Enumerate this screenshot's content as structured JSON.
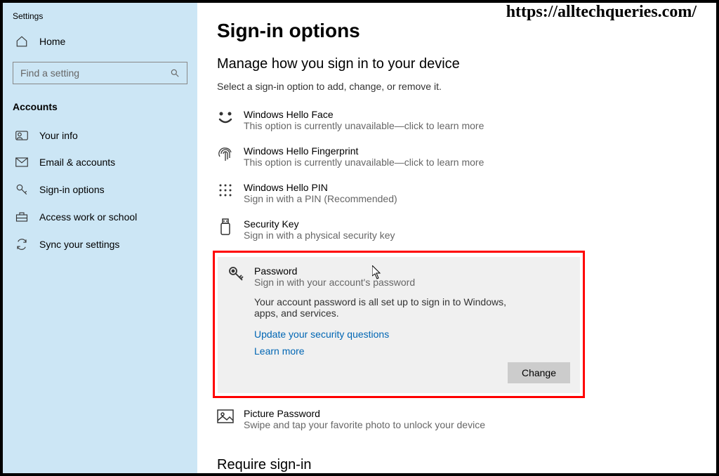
{
  "watermark": "https://alltechqueries.com/",
  "sidebar": {
    "title": "Settings",
    "home": "Home",
    "search_placeholder": "Find a setting",
    "section_header": "Accounts",
    "items": [
      {
        "label": "Your info"
      },
      {
        "label": "Email & accounts"
      },
      {
        "label": "Sign-in options"
      },
      {
        "label": "Access work or school"
      },
      {
        "label": "Sync your settings"
      }
    ]
  },
  "main": {
    "heading": "Sign-in options",
    "subheading": "Manage how you sign in to your device",
    "subtext": "Select a sign-in option to add, change, or remove it.",
    "options": {
      "face": {
        "title": "Windows Hello Face",
        "desc": "This option is currently unavailable—click to learn more"
      },
      "fingerprint": {
        "title": "Windows Hello Fingerprint",
        "desc": "This option is currently unavailable—click to learn more"
      },
      "pin": {
        "title": "Windows Hello PIN",
        "desc": "Sign in with a PIN (Recommended)"
      },
      "securitykey": {
        "title": "Security Key",
        "desc": "Sign in with a physical security key"
      },
      "password": {
        "title": "Password",
        "desc": "Sign in with your account's password",
        "message": "Your account password is all set up to sign in to Windows, apps, and services.",
        "link1": "Update your security questions",
        "link2": "Learn more",
        "button": "Change"
      },
      "picture": {
        "title": "Picture Password",
        "desc": "Swipe and tap your favorite photo to unlock your device"
      }
    },
    "require_heading": "Require sign-in"
  }
}
